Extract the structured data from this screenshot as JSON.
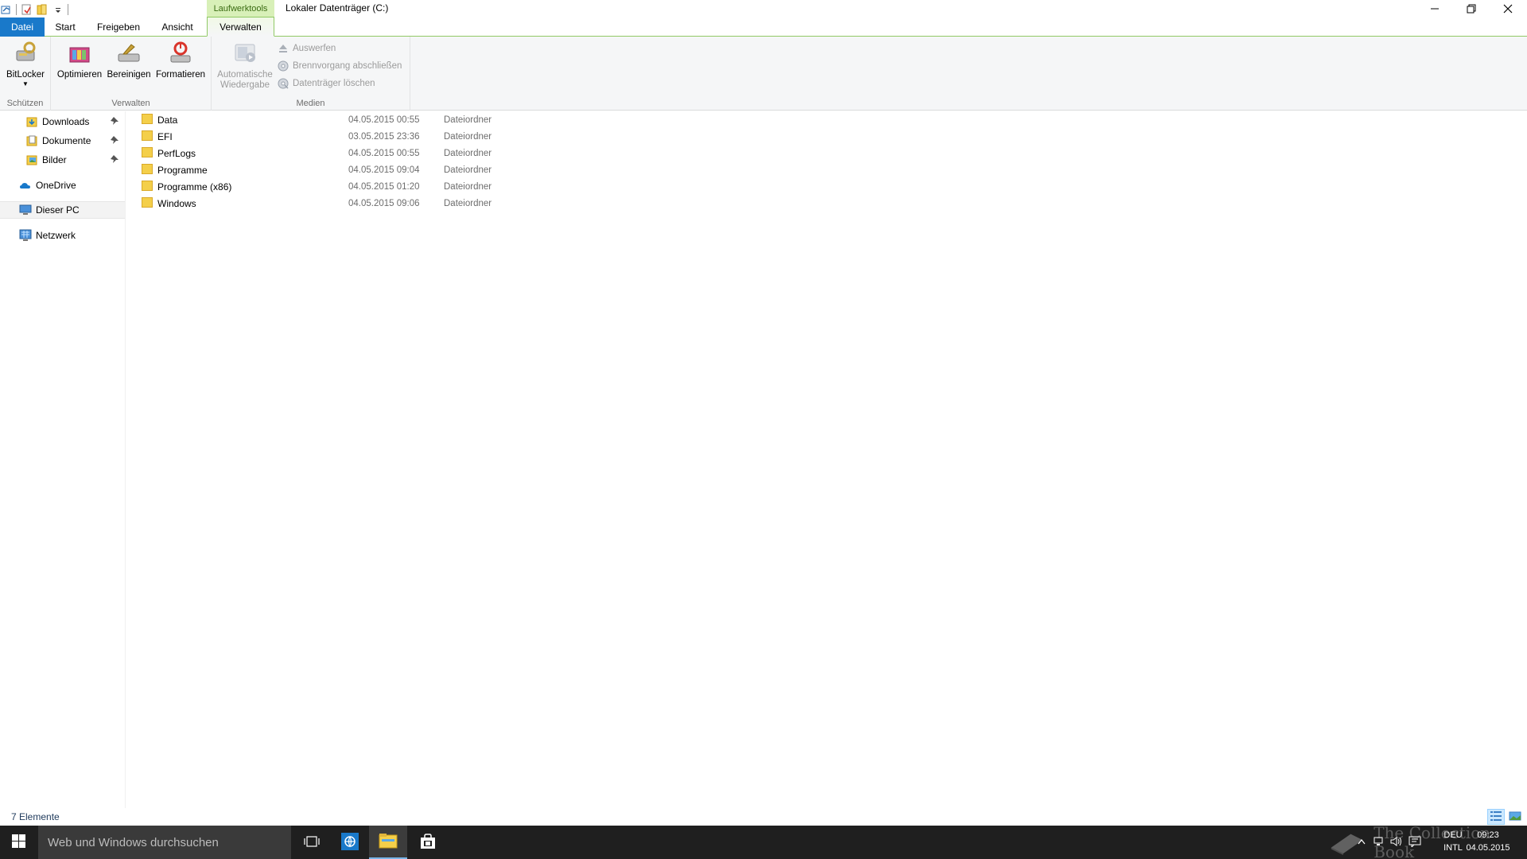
{
  "window": {
    "title": "Lokaler Datenträger (C:)",
    "context_tab_group": "Laufwerktools"
  },
  "quick_access_toolbar": {
    "icons": [
      "properties-icon",
      "new-folder-icon",
      "customize-dropdown-icon"
    ]
  },
  "tabs": [
    {
      "label": "Datei"
    },
    {
      "label": "Start"
    },
    {
      "label": "Freigeben"
    },
    {
      "label": "Ansicht"
    },
    {
      "label": "Verwalten"
    }
  ],
  "ribbon": {
    "groups": [
      {
        "label": "Schützen",
        "buttons": [
          {
            "label": "BitLocker",
            "icon": "bitlocker-icon"
          }
        ]
      },
      {
        "label": "Verwalten",
        "buttons": [
          {
            "label": "Optimieren",
            "icon": "optimize-icon"
          },
          {
            "label": "Bereinigen",
            "icon": "cleanup-icon"
          },
          {
            "label": "Formatieren",
            "icon": "format-icon"
          }
        ]
      },
      {
        "label": "Medien",
        "buttons": [
          {
            "label": "Automatische Wiedergabe",
            "label_line1": "Automatische",
            "label_line2": "Wiedergabe",
            "icon": "autoplay-icon"
          },
          {
            "label": "Auswerfen",
            "icon": "eject-icon"
          },
          {
            "label": "Brennvorgang abschließen",
            "icon": "finish-burning-icon"
          },
          {
            "label": "Datenträger löschen",
            "icon": "erase-disc-icon"
          }
        ]
      }
    ]
  },
  "nav_pane": {
    "items": [
      {
        "label": "Downloads",
        "icon": "downloads-icon",
        "pinned": true
      },
      {
        "label": "Dokumente",
        "icon": "documents-icon",
        "pinned": true
      },
      {
        "label": "Bilder",
        "icon": "pictures-icon",
        "pinned": true
      },
      {
        "label": "OneDrive",
        "icon": "onedrive-icon",
        "pinned": false
      },
      {
        "label": "Dieser PC",
        "icon": "this-pc-icon",
        "pinned": false,
        "selected": true
      },
      {
        "label": "Netzwerk",
        "icon": "network-icon",
        "pinned": false
      }
    ]
  },
  "files": [
    {
      "name": "Data",
      "modified": "04.05.2015 00:55",
      "type": "Dateiordner"
    },
    {
      "name": "EFI",
      "modified": "03.05.2015 23:36",
      "type": "Dateiordner"
    },
    {
      "name": "PerfLogs",
      "modified": "04.05.2015 00:55",
      "type": "Dateiordner"
    },
    {
      "name": "Programme",
      "modified": "04.05.2015 09:04",
      "type": "Dateiordner"
    },
    {
      "name": "Programme (x86)",
      "modified": "04.05.2015 01:20",
      "type": "Dateiordner"
    },
    {
      "name": "Windows",
      "modified": "04.05.2015 09:06",
      "type": "Dateiordner"
    }
  ],
  "status_bar": {
    "item_count": "7 Elemente"
  },
  "taskbar": {
    "search_placeholder": "Web und Windows durchsuchen",
    "language_line1": "DEU",
    "language_line2": "INTL",
    "time": "09:23",
    "date": "04.05.2015",
    "watermark": "The Collection Book"
  },
  "colors": {
    "file_tab": "#1979ca",
    "context_tab": "#d8f0b8",
    "folder": "#f4cf4a",
    "taskbar": "#1f1f1f",
    "status_text": "#1e395b"
  }
}
